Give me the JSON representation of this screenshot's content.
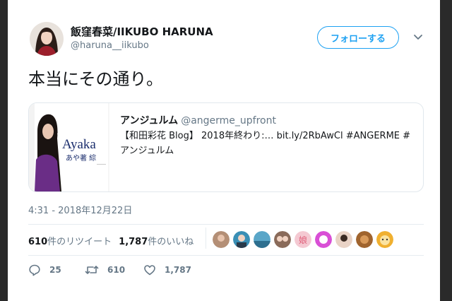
{
  "user": {
    "display_name": "飯窪春菜/IIKUBO HARUNA",
    "handle": "@haruna__iikubo"
  },
  "follow_button": {
    "label": "フォローする"
  },
  "tweet": {
    "text": "本当にその通り。"
  },
  "quoted_tweet": {
    "author_name": "アンジュルム",
    "author_handle": "@angerme_upfront",
    "text_line1": "【和田彩花 Blog】 2018年終わり:… bit.ly/2RbAwCl #ANGERME #",
    "text_line2": "アンジュルム",
    "media_caption_en": "Ayaka",
    "media_caption_jp": "あや著 綜"
  },
  "timestamp": "4:31 - 2018年12月22日",
  "stats": {
    "retweets_count": "610",
    "retweets_label": "件のリツイート",
    "likes_count": "1,787",
    "likes_label": "件のいいね"
  },
  "likers": {
    "items": [
      {
        "color": "#b48f76"
      },
      {
        "color": "#3a8fb5"
      },
      {
        "color": "#5aa6c8"
      },
      {
        "color": "#8a6b5a"
      },
      {
        "color": "#f4c9d2",
        "label": "娘"
      },
      {
        "color": "#d94fd6"
      },
      {
        "color": "#e9d3c6"
      },
      {
        "color": "#a0642e"
      },
      {
        "color": "#f0b030"
      }
    ]
  },
  "actions": {
    "reply_count": "25",
    "retweet_count": "610",
    "like_count": "1,787"
  },
  "colors": {
    "accent": "#1da1f2",
    "secondary_text": "#657786",
    "primary_text": "#14171a"
  },
  "icons": {
    "chevron": "chevron-down-icon",
    "reply": "reply-icon",
    "retweet": "retweet-icon",
    "like": "heart-icon"
  }
}
